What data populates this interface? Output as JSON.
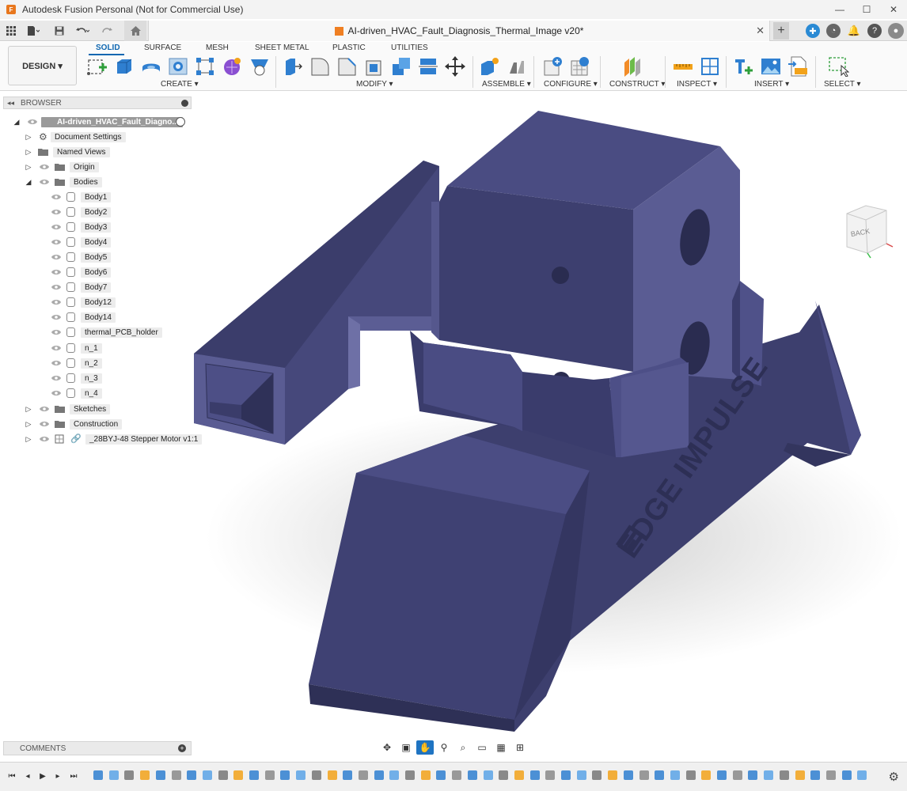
{
  "window": {
    "title": "Autodesk Fusion Personal (Not for Commercial Use)",
    "minimize_glyph": "—",
    "maximize_glyph": "☐",
    "close_glyph": "✕"
  },
  "document_tab": {
    "title": "AI-driven_HVAC_Fault_Diagnosis_Thermal_Image v20*",
    "close_glyph": "✕",
    "new_tab_glyph": "+"
  },
  "workspace": {
    "label": "DESIGN ▾"
  },
  "ribbon": {
    "tabs": [
      {
        "label": "SOLID",
        "active": true
      },
      {
        "label": "SURFACE",
        "active": false
      },
      {
        "label": "MESH",
        "active": false
      },
      {
        "label": "SHEET METAL",
        "active": false
      },
      {
        "label": "PLASTIC",
        "active": false
      },
      {
        "label": "UTILITIES",
        "active": false
      }
    ],
    "groups": [
      "CREATE ▾",
      "MODIFY ▾",
      "ASSEMBLE ▾",
      "CONFIGURE ▾",
      "CONSTRUCT ▾",
      "INSPECT ▾",
      "INSERT ▾",
      "SELECT ▾"
    ]
  },
  "browser": {
    "header": "BROWSER",
    "root": "AI-driven_HVAC_Fault_Diagno...",
    "items": [
      {
        "label": "Document Settings",
        "type": "gear"
      },
      {
        "label": "Named Views",
        "type": "folder"
      },
      {
        "label": "Origin",
        "type": "folder"
      },
      {
        "label": "Bodies",
        "type": "folder"
      },
      {
        "label": "Body1",
        "type": "body"
      },
      {
        "label": "Body2",
        "type": "body"
      },
      {
        "label": "Body3",
        "type": "body"
      },
      {
        "label": "Body4",
        "type": "body"
      },
      {
        "label": "Body5",
        "type": "body"
      },
      {
        "label": "Body6",
        "type": "body"
      },
      {
        "label": "Body7",
        "type": "body"
      },
      {
        "label": "Body12",
        "type": "body"
      },
      {
        "label": "Body14",
        "type": "body"
      },
      {
        "label": "thermal_PCB_holder",
        "type": "body"
      },
      {
        "label": "n_1",
        "type": "body"
      },
      {
        "label": "n_2",
        "type": "body"
      },
      {
        "label": "n_3",
        "type": "body"
      },
      {
        "label": "n_4",
        "type": "body"
      },
      {
        "label": "Sketches",
        "type": "folder"
      },
      {
        "label": "Construction",
        "type": "folder"
      },
      {
        "label": "_28BYJ-48 Stepper Motor v1:1",
        "type": "link"
      }
    ]
  },
  "viewcube": {
    "label": "BACK"
  },
  "model": {
    "logo_text": "EDGE IMPULSE",
    "color": "#3b3d6b"
  },
  "comments": {
    "label": "COMMENTS",
    "add_glyph": "+"
  },
  "colors": {
    "accent": "#0f67b1",
    "model": "#3b3d6b"
  }
}
